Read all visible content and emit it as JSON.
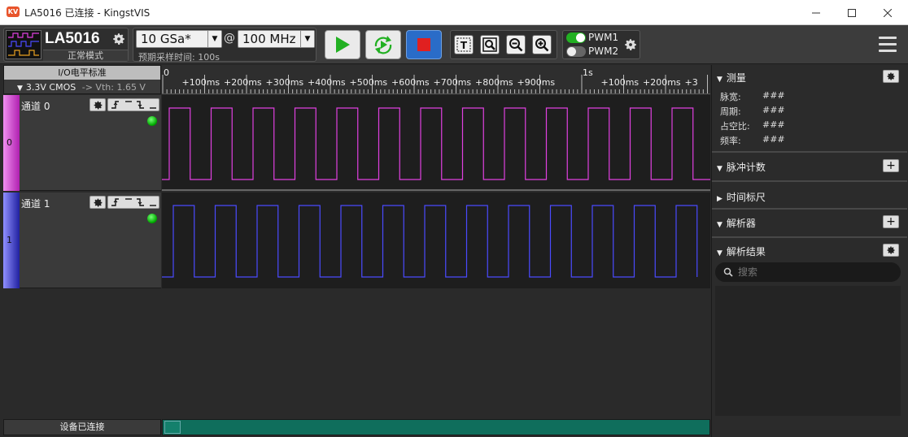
{
  "window": {
    "title": "LA5016 已连接 - KingstVIS",
    "logo": "KV"
  },
  "device": {
    "name": "LA5016",
    "mode": "正常模式"
  },
  "sampling": {
    "rate": "10 GSa*",
    "at": "@",
    "freq": "100 MHz",
    "estimate": "预期采样时间: 100s"
  },
  "pwm": {
    "pwm1": "PWM1",
    "pwm2": "PWM2"
  },
  "io": {
    "header": "I/O电平标准",
    "standard": "3.3V CMOS",
    "vth": "-> Vth: 1.65 V"
  },
  "timeline": {
    "ticks": [
      "0",
      "+100ms",
      "+200ms",
      "+300ms",
      "+400ms",
      "+500ms",
      "+600ms",
      "+700ms",
      "+800ms",
      "+900ms",
      "1s",
      "+100ms",
      "+200ms",
      "+3"
    ]
  },
  "channels": [
    {
      "label": "通道 0",
      "index": "0",
      "color": "#e040e0",
      "strip": "#d030d0"
    },
    {
      "label": "通道 1",
      "index": "1",
      "color": "#4a4aff",
      "strip": "#3030c0"
    }
  ],
  "measure": {
    "title": "测量",
    "rows": [
      {
        "k": "脉宽:",
        "v": "###"
      },
      {
        "k": "周期:",
        "v": "###"
      },
      {
        "k": "占空比:",
        "v": "###"
      },
      {
        "k": "频率:",
        "v": "###"
      }
    ]
  },
  "sections": {
    "pulse": "脉冲计数",
    "ruler": "时间标尺",
    "decoder": "解析器",
    "results": "解析结果"
  },
  "search": {
    "placeholder": "搜索"
  },
  "status": {
    "text": "设备已连接"
  }
}
